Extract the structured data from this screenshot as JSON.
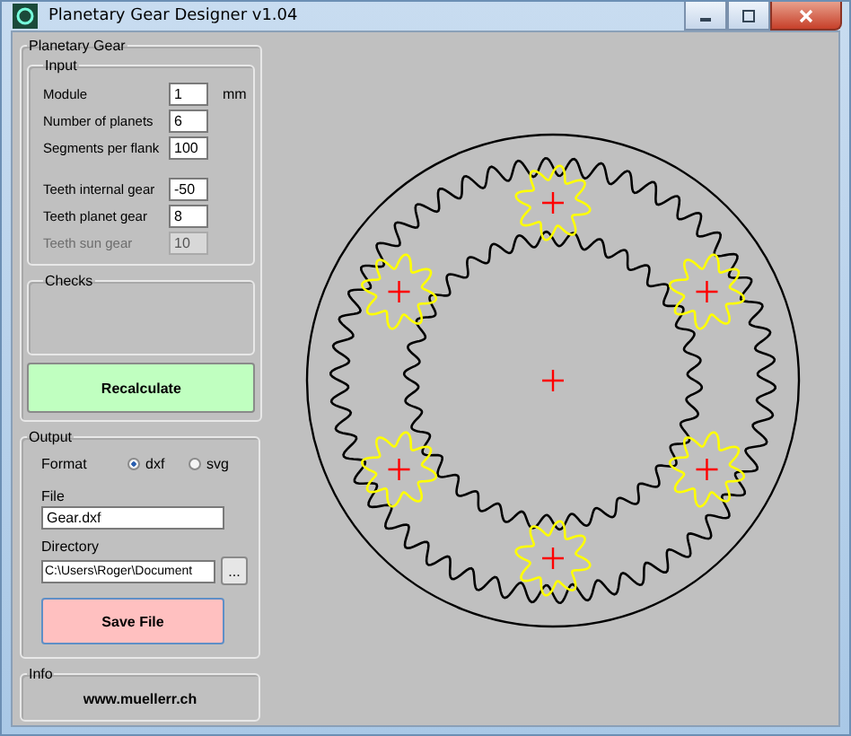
{
  "window": {
    "title": "Planetary Gear Designer v1.04"
  },
  "planetary_gear": {
    "title": "Planetary Gear",
    "input": {
      "title": "Input",
      "sections": [
        {
          "fields": [
            {
              "label": "Module",
              "value": "1",
              "unit": "mm",
              "disabled": false
            },
            {
              "label": "Number of planets",
              "value": "6",
              "disabled": false
            },
            {
              "label": "Segments per flank",
              "value": "100",
              "disabled": false
            }
          ]
        },
        {
          "fields": [
            {
              "label": "Teeth internal gear",
              "value": "-50",
              "disabled": false
            },
            {
              "label": "Teeth planet gear",
              "value": "8",
              "disabled": false
            },
            {
              "label": "Teeth sun gear",
              "value": "10",
              "disabled": true
            }
          ]
        }
      ]
    },
    "checks": {
      "title": "Checks"
    },
    "recalculate_button": "Recalculate"
  },
  "output": {
    "title": "Output",
    "format_label": "Format",
    "formats": [
      {
        "label": "dxf",
        "selected": true
      },
      {
        "label": "svg",
        "selected": false
      }
    ],
    "file_label": "File",
    "file_value": "Gear.dxf",
    "directory_label": "Directory",
    "directory_value": "C:\\Users\\Roger\\Document",
    "browse_button": "...",
    "save_button": "Save File"
  },
  "info": {
    "title": "Info",
    "link": "www.muellerr.ch"
  }
}
